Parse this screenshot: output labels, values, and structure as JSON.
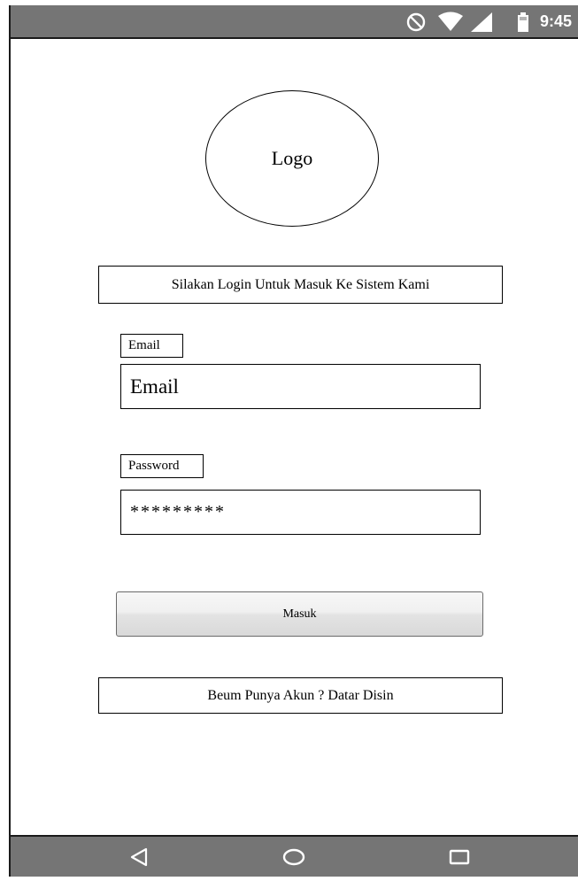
{
  "status_bar": {
    "time": "9:45",
    "icons": [
      "do-not-disturb-icon",
      "wifi-icon",
      "signal-icon",
      "battery-icon"
    ],
    "background": "#757575"
  },
  "logo": {
    "label": "Logo"
  },
  "welcome": {
    "text": "Silakan Login Untuk Masuk Ke Sistem Kami"
  },
  "email": {
    "label": "Email",
    "placeholder": "Email"
  },
  "password": {
    "label": "Password",
    "value": "*********"
  },
  "login_button": {
    "label": "Masuk"
  },
  "register": {
    "text": "Beum Punya Akun ? Datar Disin"
  },
  "nav_bar": {
    "icons": [
      "back-icon",
      "home-icon",
      "recent-apps-icon"
    ],
    "background": "#757575"
  }
}
